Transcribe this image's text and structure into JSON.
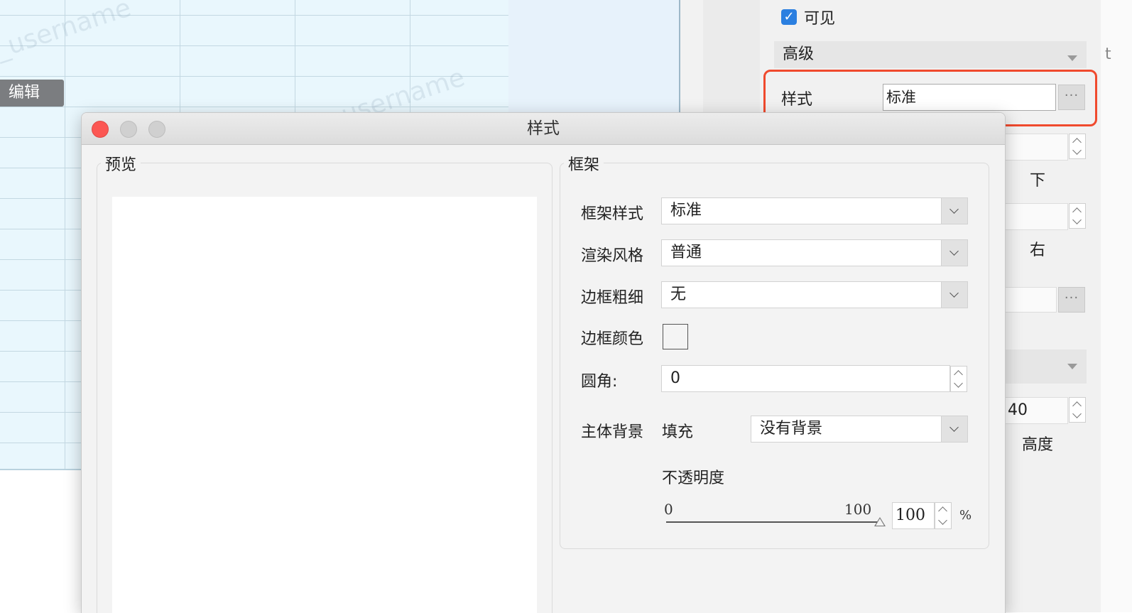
{
  "background": {
    "watermark_text": "_username",
    "edit_button": "编辑"
  },
  "panel": {
    "visible_label": "可见",
    "advanced_label": "高级",
    "style_label": "样式",
    "style_value": "标准",
    "dots": "···",
    "label_bottom": "下",
    "label_right": "右",
    "height_value": "40",
    "label_height": "高度",
    "edge_letter": "t"
  },
  "dialog": {
    "title": "样式",
    "preview_group": "预览",
    "frame_group": "框架",
    "frame_style_label": "框架样式",
    "frame_style_value": "标准",
    "render_style_label": "渲染风格",
    "render_style_value": "普通",
    "border_width_label": "边框粗细",
    "border_width_value": "无",
    "border_color_label": "边框颜色",
    "corner_label": "圆角:",
    "corner_value": "0",
    "body_bg_label": "主体背景",
    "fill_label": "填充",
    "fill_value": "没有背景",
    "opacity_label": "不透明度",
    "slider_min": "0",
    "slider_max": "100",
    "opacity_value": "100",
    "percent": "%"
  },
  "colors": {
    "highlight": "#f04a2e",
    "checkbox": "#2b7fe0",
    "close_button": "#fc5753"
  }
}
